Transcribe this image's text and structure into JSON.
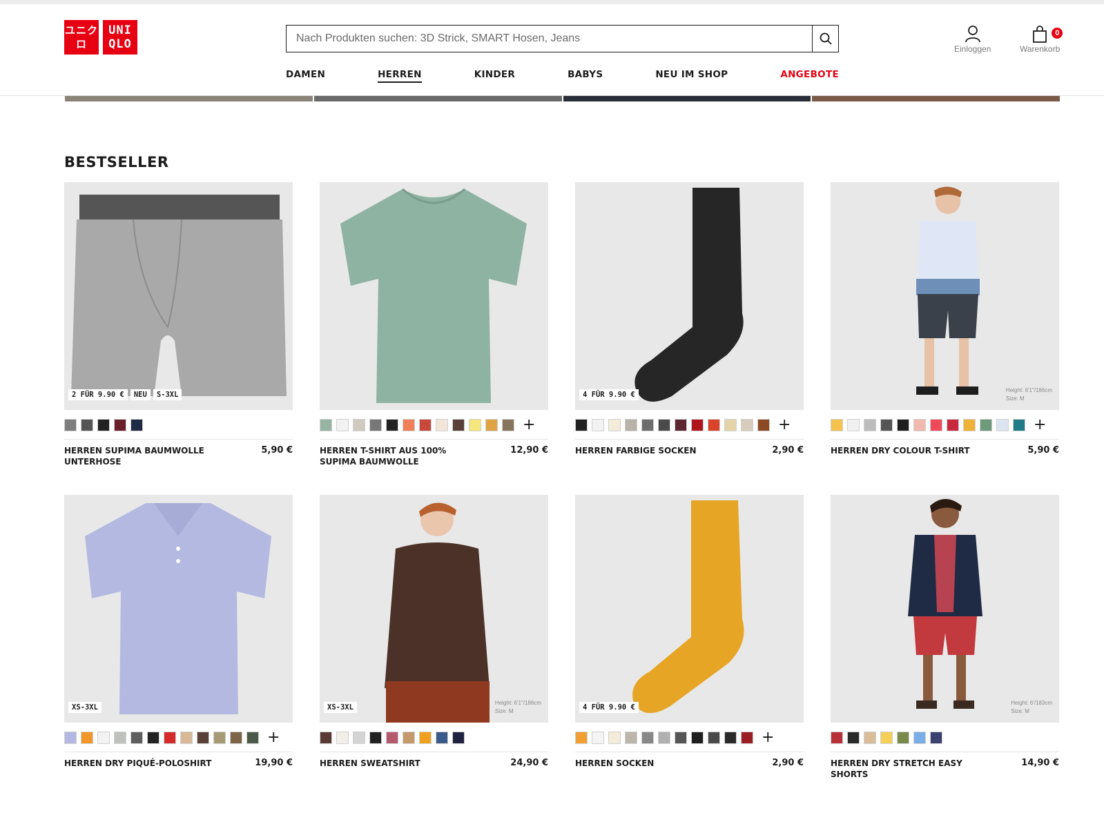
{
  "brand": {
    "logo_left": "ユニクロ",
    "logo_right": "UNI QLO",
    "color": "#e60012"
  },
  "search": {
    "placeholder": "Nach Produkten suchen: 3D Strick, SMART Hosen, Jeans",
    "icon": "search-icon"
  },
  "account": {
    "login_label": "Einloggen",
    "cart_label": "Warenkorb",
    "cart_count": "0"
  },
  "nav": [
    {
      "label": "DAMEN"
    },
    {
      "label": "HERREN"
    },
    {
      "label": "KINDER"
    },
    {
      "label": "BABYS"
    },
    {
      "label": "NEU IM SHOP"
    },
    {
      "label": "ANGEBOTE"
    }
  ],
  "section_title": "BESTSELLER",
  "products": [
    {
      "name": "HERREN SUPIMA BAUMWOLLE UNTERHOSE",
      "price": "5,90 €",
      "flags": [
        "2 FÜR 9.90 €",
        "NEU",
        "S-3XL"
      ],
      "colors": [
        "#7e7e7e",
        "#555555",
        "#222222",
        "#6b1f2a",
        "#1f2a44"
      ],
      "more": false,
      "bg": "#e8e8e8"
    },
    {
      "name": "HERREN T-SHIRT AUS 100% SUPIMA BAUMWOLLE",
      "price": "12,90 €",
      "flags": [],
      "colors": [
        "#96b3a3",
        "#f2f2f2",
        "#cfcac0",
        "#777777",
        "#222222",
        "#f07f5a",
        "#c8483c",
        "#f3e5d8",
        "#5a4036",
        "#f5e67c",
        "#e0a342",
        "#86755c"
      ],
      "more": true,
      "bg": "#e8e8e8"
    },
    {
      "name": "HERREN FARBIGE SOCKEN",
      "price": "2,90 €",
      "flags": [
        "4 FÜR 9.90 €"
      ],
      "colors": [
        "#222222",
        "#f2f2f2",
        "#f3ecd9",
        "#b8b3aa",
        "#6d6d6d",
        "#4a4a4a",
        "#5c2733",
        "#b0151e",
        "#d9432a",
        "#e5d3a8",
        "#d8cdbc",
        "#8c4a24"
      ],
      "more": true,
      "bg": "#e8e8e8"
    },
    {
      "name": "HERREN DRY COLOUR T-SHIRT",
      "price": "5,90 €",
      "flags": [],
      "colors": [
        "#f5c24e",
        "#f0f0f0",
        "#bcbcbc",
        "#555555",
        "#1e1e1e",
        "#f2b8b0",
        "#f04a5a",
        "#c8283c",
        "#f0b236",
        "#6e9b7a",
        "#dde4f2",
        "#1f7c86"
      ],
      "more": true,
      "bg": "#e8e8e8",
      "height_note": "Height: 6'1\"/186cm\nSize: M"
    },
    {
      "name": "HERREN DRY PIQUÉ-POLOSHIRT",
      "price": "19,90 €",
      "flags": [
        "XS-3XL"
      ],
      "colors": [
        "#b4b8e0",
        "#f0962a",
        "#f2f2f2",
        "#bfc2bc",
        "#5e5e5e",
        "#222222",
        "#d42a2a",
        "#d8b896",
        "#5a4036",
        "#a69a74",
        "#7d6448",
        "#4b5a48"
      ],
      "more": true,
      "bg": "#e8e8e8"
    },
    {
      "name": "HERREN SWEATSHIRT",
      "price": "24,90 €",
      "flags": [
        "XS-3XL"
      ],
      "colors": [
        "#5a3a34",
        "#f2efe9",
        "#d4d4d4",
        "#222222",
        "#b45a6a",
        "#c59a6b",
        "#f0a020",
        "#3a5a8a",
        "#1f2240"
      ],
      "more": false,
      "bg": "#e8e8e8",
      "height_note": "Height: 6'1\"/186cm\nSize: M"
    },
    {
      "name": "HERREN SOCKEN",
      "price": "2,90 €",
      "flags": [
        "4 FÜR 9.90 €"
      ],
      "colors": [
        "#f0a030",
        "#f4f4f4",
        "#f3ecd9",
        "#bdb6aa",
        "#888888",
        "#b0b0b0",
        "#555555",
        "#1e1e1e",
        "#4a4a4a",
        "#2a2a2a",
        "#9a1e24"
      ],
      "more": true,
      "bg": "#e8e8e8"
    },
    {
      "name": "HERREN DRY STRETCH EASY SHORTS",
      "price": "14,90 €",
      "flags": [],
      "colors": [
        "#b8303a",
        "#2a2a2a",
        "#d8bd98",
        "#f5cf5a",
        "#7a8a4a",
        "#7aaee8",
        "#3a4270"
      ],
      "more": false,
      "bg": "#e8e8e8",
      "height_note": "Height: 6'/183cm\nSize: M"
    }
  ]
}
